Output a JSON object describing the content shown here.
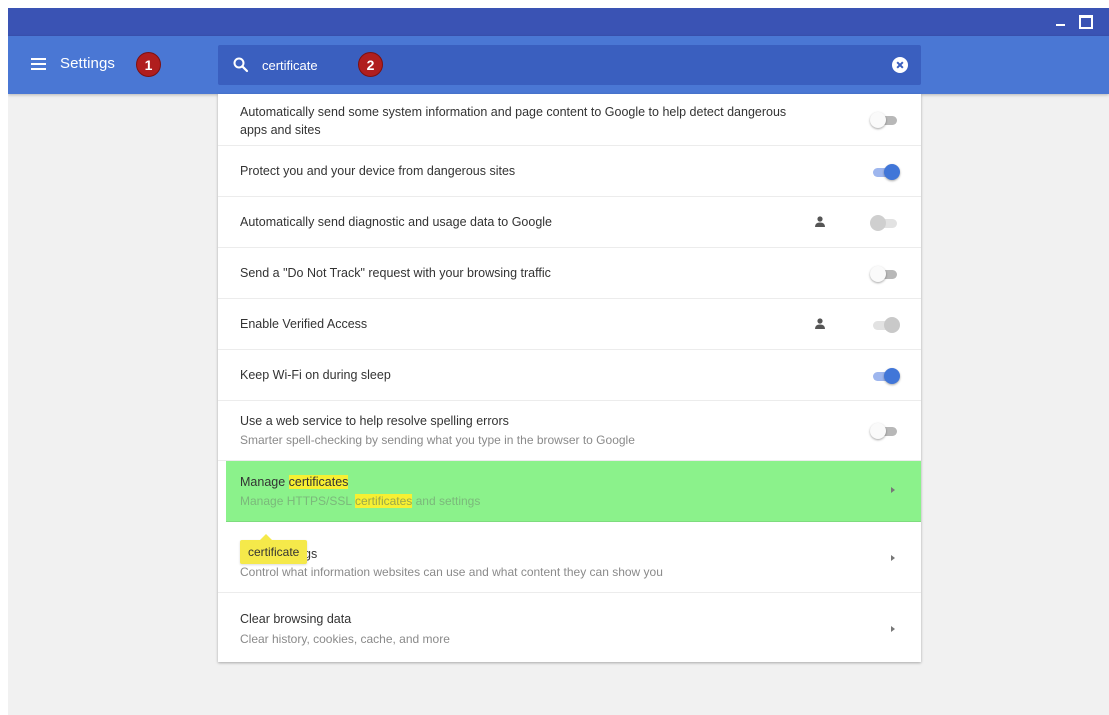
{
  "window": {
    "minimize_icon": "minimize-icon",
    "maximize_icon": "maximize-icon"
  },
  "header": {
    "menu_icon": "hamburger-menu-icon",
    "title": "Settings",
    "badge_1": "1",
    "badge_2": "2"
  },
  "search": {
    "icon": "search-icon",
    "value": "certificate",
    "clear_icon": "clear-search-icon"
  },
  "settings_rows": [
    {
      "label": "Automatically send some system information and page content to Google to help detect dangerous",
      "label_line2": "apps and sites",
      "control": "toggle",
      "state": "off"
    },
    {
      "label": "Protect you and your device from dangerous sites",
      "control": "toggle",
      "state": "on"
    },
    {
      "label": "Automatically send diagnostic and usage data to Google",
      "control": "toggle",
      "state": "disabled-off",
      "policy_icon": "person-policy-icon"
    },
    {
      "label": "Send a \"Do Not Track\" request with your browsing traffic",
      "control": "toggle",
      "state": "off"
    },
    {
      "label": "Enable Verified Access",
      "control": "toggle",
      "state": "disabled-on",
      "policy_icon": "person-policy-icon"
    },
    {
      "label": "Keep Wi-Fi on during sleep",
      "control": "toggle",
      "state": "on"
    },
    {
      "label": "Use a web service to help resolve spelling errors",
      "sublabel": "Smarter spell-checking by sending what you type in the browser to Google",
      "control": "toggle",
      "state": "off"
    },
    {
      "label_prefix": "Manage ",
      "label_highlight": "certificates",
      "sub_prefix": "Manage HTTPS/SSL ",
      "sub_highlight": "certificates",
      "sub_suffix": " and settings",
      "control": "chevron",
      "highlighted": true
    },
    {
      "label_visible": "gs",
      "sublabel": "Control what information websites can use and what content they can show you",
      "control": "chevron"
    },
    {
      "label": "Clear browsing data",
      "sublabel": "Clear history, cookies, cache, and more",
      "control": "chevron"
    }
  ],
  "search_tooltip": "certificate",
  "colors": {
    "titlebar": "#3a53b4",
    "toolbar": "#4a77d4",
    "search_bg": "#3a5fbf",
    "badge": "#b01e1e",
    "highlight_row": "#8bf28b",
    "highlight_text": "#f7f032",
    "toggle_on": "#4176d8"
  }
}
